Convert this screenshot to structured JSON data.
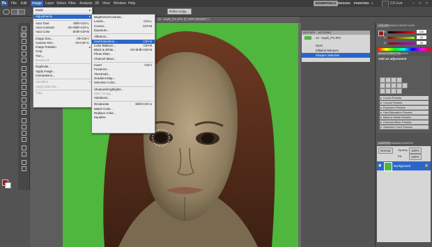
{
  "menubar": {
    "logo": "Ps",
    "items": [
      "File",
      "Edit",
      "Image",
      "Layer",
      "Select",
      "Filter",
      "Analysis",
      "3D",
      "View",
      "Window",
      "Help"
    ],
    "workspaces": [
      "ESSENTIALS",
      "DESIGN",
      "PAINTING"
    ],
    "cs_live": "CS Live"
  },
  "optbar": {
    "refine_edge": "Refine Edge..."
  },
  "doc_tab": {
    "title": "13 - Sophi_PS.JPG @ 100% (RGB/8*) ×"
  },
  "image_menu": [
    {
      "label": "Mode",
      "shortcut": "",
      "arrow": true,
      "disabled": false
    },
    {
      "sep": true
    },
    {
      "label": "Adjustments",
      "shortcut": "",
      "arrow": true,
      "disabled": false,
      "highlight": true
    },
    {
      "sep": true
    },
    {
      "label": "Auto Tone",
      "shortcut": "Shift+Ctrl+L",
      "disabled": false
    },
    {
      "label": "Auto Contrast",
      "shortcut": "Alt+Shift+Ctrl+L",
      "disabled": false
    },
    {
      "label": "Auto Color",
      "shortcut": "Shift+Ctrl+B",
      "disabled": false
    },
    {
      "sep": true
    },
    {
      "label": "Image Size...",
      "shortcut": "Alt+Ctrl+I",
      "disabled": false
    },
    {
      "label": "Canvas Size...",
      "shortcut": "Alt+Ctrl+C",
      "disabled": false
    },
    {
      "label": "Image Rotation",
      "shortcut": "",
      "arrow": true,
      "disabled": false
    },
    {
      "label": "Crop",
      "shortcut": "",
      "disabled": false
    },
    {
      "label": "Trim...",
      "shortcut": "",
      "disabled": false
    },
    {
      "label": "Reveal All",
      "shortcut": "",
      "disabled": true
    },
    {
      "sep": true
    },
    {
      "label": "Duplicate...",
      "shortcut": "",
      "disabled": false
    },
    {
      "label": "Apply Image...",
      "shortcut": "",
      "disabled": false
    },
    {
      "label": "Calculations...",
      "shortcut": "",
      "disabled": false
    },
    {
      "sep": true
    },
    {
      "label": "Variables",
      "shortcut": "",
      "arrow": true,
      "disabled": true
    },
    {
      "label": "Apply Data Set...",
      "shortcut": "",
      "disabled": true
    },
    {
      "sep": true
    },
    {
      "label": "Trap...",
      "shortcut": "",
      "disabled": true
    }
  ],
  "adjustments_menu": [
    {
      "label": "Brightness/Contrast...",
      "shortcut": ""
    },
    {
      "label": "Levels...",
      "shortcut": "Ctrl+L"
    },
    {
      "label": "Curves...",
      "shortcut": "Ctrl+M"
    },
    {
      "label": "Exposure...",
      "shortcut": ""
    },
    {
      "sep": true
    },
    {
      "label": "Vibrance...",
      "shortcut": ""
    },
    {
      "label": "Hue/Saturation...",
      "shortcut": "Ctrl+U",
      "highlight": true
    },
    {
      "label": "Color Balance...",
      "shortcut": "Ctrl+B"
    },
    {
      "label": "Black & White...",
      "shortcut": "Alt+Shift+Ctrl+B"
    },
    {
      "label": "Photo Filter...",
      "shortcut": ""
    },
    {
      "label": "Channel Mixer...",
      "shortcut": ""
    },
    {
      "sep": true
    },
    {
      "label": "Invert",
      "shortcut": "Ctrl+I"
    },
    {
      "label": "Posterize...",
      "shortcut": ""
    },
    {
      "label": "Threshold...",
      "shortcut": ""
    },
    {
      "label": "Gradient Map...",
      "shortcut": ""
    },
    {
      "label": "Selective Color...",
      "shortcut": ""
    },
    {
      "sep": true
    },
    {
      "label": "Shadows/Highlights...",
      "shortcut": ""
    },
    {
      "label": "HDR Toning...",
      "shortcut": "",
      "disabled": true
    },
    {
      "label": "Variations...",
      "shortcut": ""
    },
    {
      "sep": true
    },
    {
      "label": "Desaturate",
      "shortcut": "Shift+Ctrl+U"
    },
    {
      "label": "Match Color...",
      "shortcut": ""
    },
    {
      "label": "Replace Color...",
      "shortcut": ""
    },
    {
      "label": "Equalize",
      "shortcut": ""
    }
  ],
  "history": {
    "tabs": [
      "HISTORY",
      "ACTIONS"
    ],
    "doc": "13 - Sophi_PS.JPG",
    "rows": [
      "Open",
      "Elliptical Marquee",
      "Sharpen Selection"
    ]
  },
  "color_panel": {
    "tabs": [
      "COLOR",
      "SWATCHES",
      "STYLES"
    ],
    "r": "150",
    "g": "30",
    "b": "30"
  },
  "adjustments_panel": {
    "tabs": [
      "ADJUSTMENTS",
      "MASKS"
    ],
    "heading": "Add an adjustment",
    "presets": [
      "Levels Presets",
      "Curves Presets",
      "Exposure Presets",
      "Hue/Saturation Presets",
      "Black & White Presets",
      "Channel Mixer Presets",
      "Selective Color Presets"
    ]
  },
  "layers_panel": {
    "tabs": [
      "LAYERS",
      "CHANNELS",
      "PATHS"
    ],
    "blend": "Normal",
    "opacity_label": "Opacity:",
    "opacity": "100%",
    "fill_label": "Fill:",
    "fill": "100%",
    "layer_name": "Background"
  },
  "colors": {
    "accent": "#2a66c9",
    "canvas_green": "#4fb63e",
    "foreground": "#9a1a1a"
  }
}
